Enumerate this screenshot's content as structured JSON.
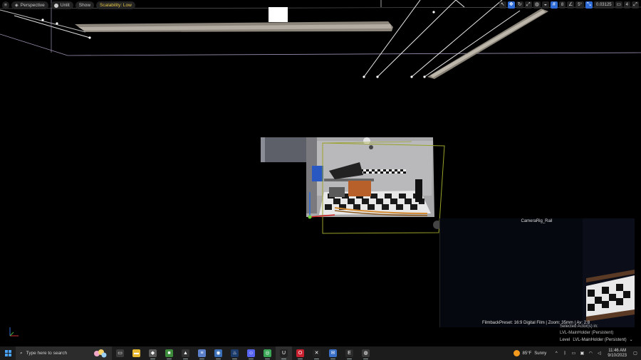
{
  "viewport": {
    "menu_icon": "hamburger-icon",
    "view_mode": "Perspective",
    "lighting_mode": "Unlit",
    "show_label": "Show",
    "scalability_label": "Scalability: Low",
    "camera_speed": "8",
    "grid_snap_value": "5°",
    "scale_snap_value": "0.03125",
    "camera_count": "4",
    "accent_color": "#2f6bd6"
  },
  "camera_preview": {
    "title": "CameraRig_Rail",
    "caption": "FilmbackPreset: 16:9 Digital Film | Zoom: 35mm | Av: 2.8"
  },
  "selection": {
    "selected_label": "Selected Actor(s) in:",
    "level_name": "LVL-MainHolder (Persistent)"
  },
  "level_bar": {
    "label": "Level",
    "value": "LVL-MainHolder (Persistent)"
  },
  "taskbar": {
    "search_placeholder": "Type here to search",
    "apps": [
      {
        "name": "task-view-icon",
        "glyph": "▭",
        "color": "#3a3a3a"
      },
      {
        "name": "file-explorer-icon",
        "glyph": "▬",
        "color": "#e8b830"
      },
      {
        "name": "roblox-icon",
        "glyph": "◆",
        "color": "#5a5a5a"
      },
      {
        "name": "minecraft-icon",
        "glyph": "■",
        "color": "#3c8c3c"
      },
      {
        "name": "epic-launcher-icon",
        "glyph": "▲",
        "color": "#333"
      },
      {
        "name": "notepad-icon",
        "glyph": "≡",
        "color": "#5b7fc8"
      },
      {
        "name": "blender-icon",
        "glyph": "◉",
        "color": "#3b6fb8"
      },
      {
        "name": "steam-icon",
        "glyph": "♨",
        "color": "#1b3b6a"
      },
      {
        "name": "discord-icon",
        "glyph": "☺",
        "color": "#5865f2"
      },
      {
        "name": "chrome-icon",
        "glyph": "◎",
        "color": "#3aa757"
      },
      {
        "name": "unreal-engine-icon",
        "glyph": "U",
        "color": "#222"
      },
      {
        "name": "opera-icon",
        "glyph": "O",
        "color": "#c8202f"
      },
      {
        "name": "capcut-icon",
        "glyph": "✕",
        "color": "#222"
      },
      {
        "name": "mail-icon",
        "glyph": "✉",
        "color": "#3a6fc8"
      },
      {
        "name": "epic-games-icon",
        "glyph": "E",
        "color": "#2a2a2a"
      },
      {
        "name": "obs-icon",
        "glyph": "◍",
        "color": "#3a3a3a"
      }
    ],
    "weather_temp": "85°F",
    "weather_cond": "Sunny",
    "time": "11:46 AM",
    "date": "9/10/2023"
  }
}
